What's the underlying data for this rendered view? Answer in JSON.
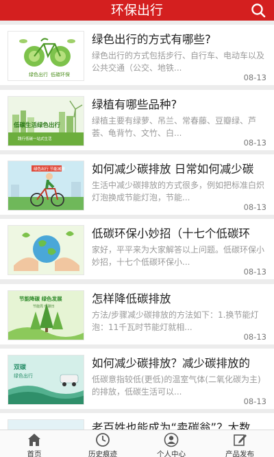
{
  "header": {
    "title": "环保出行",
    "search_icon": "search-icon"
  },
  "articles": [
    {
      "title": "绿色出行的方式有哪些?",
      "summary": "绿色出行的方式包括步行、自行车、电动车以及公共交通（公交、地铁...",
      "date": "08-13",
      "thumb_text": [
        "绿色出行",
        "低碳环保"
      ]
    },
    {
      "title": "绿植有哪些品种?",
      "summary": "绿植主要有绿萝、吊兰、常春藤、豆瓣绿、芦荟、龟背竹、文竹、白...",
      "date": "08-13",
      "thumb_text": [
        "低碳生活绿色出行",
        "践行低碳一站式生活"
      ]
    },
    {
      "title": "如何减少碳排放 日常如何减少碳",
      "summary": "生活中减少碳排放的方式很多，例如把标准白炽灯泡换成节能灯泡，节能...",
      "date": "08-13",
      "thumb_text": [
        "绿色出行 节能减排"
      ]
    },
    {
      "title": "低碳环保小妙招（十七个低碳环",
      "summary": "家好，平平来为大家解答以上问题。低碳环保小妙招，十七个低碳环保小...",
      "date": "08-13",
      "thumb_text": []
    },
    {
      "title": "怎样降低碳排放",
      "summary": "方法/步骤减少碳排放的方法如下：1.换节能灯泡：11千瓦时节能灯就相...",
      "date": "08-13",
      "thumb_text": [
        "节能降碳 绿色发展",
        "节能周 低碳日"
      ]
    },
    {
      "title": "如何减少碳排放？减少碳排放的",
      "summary": "低碳意指较低(更低)的温室气体(二氧化碳为主)的排放，低碳生活可以...",
      "date": "08-13",
      "thumb_text": [
        "双碳",
        "绿色出行"
      ]
    },
    {
      "title": "老百姓也能成为“卖碳翁”？大数",
      "summary": "",
      "date": "",
      "thumb_text": []
    }
  ],
  "tabbar": [
    {
      "label": "首页",
      "icon": "home-icon"
    },
    {
      "label": "历史痕迹",
      "icon": "clock-icon"
    },
    {
      "label": "个人中心",
      "icon": "user-icon"
    },
    {
      "label": "产品发布",
      "icon": "edit-icon"
    }
  ],
  "colors": {
    "brand": "#d41f1f",
    "background": "#ececec",
    "title": "#222222",
    "summary": "#999999"
  }
}
